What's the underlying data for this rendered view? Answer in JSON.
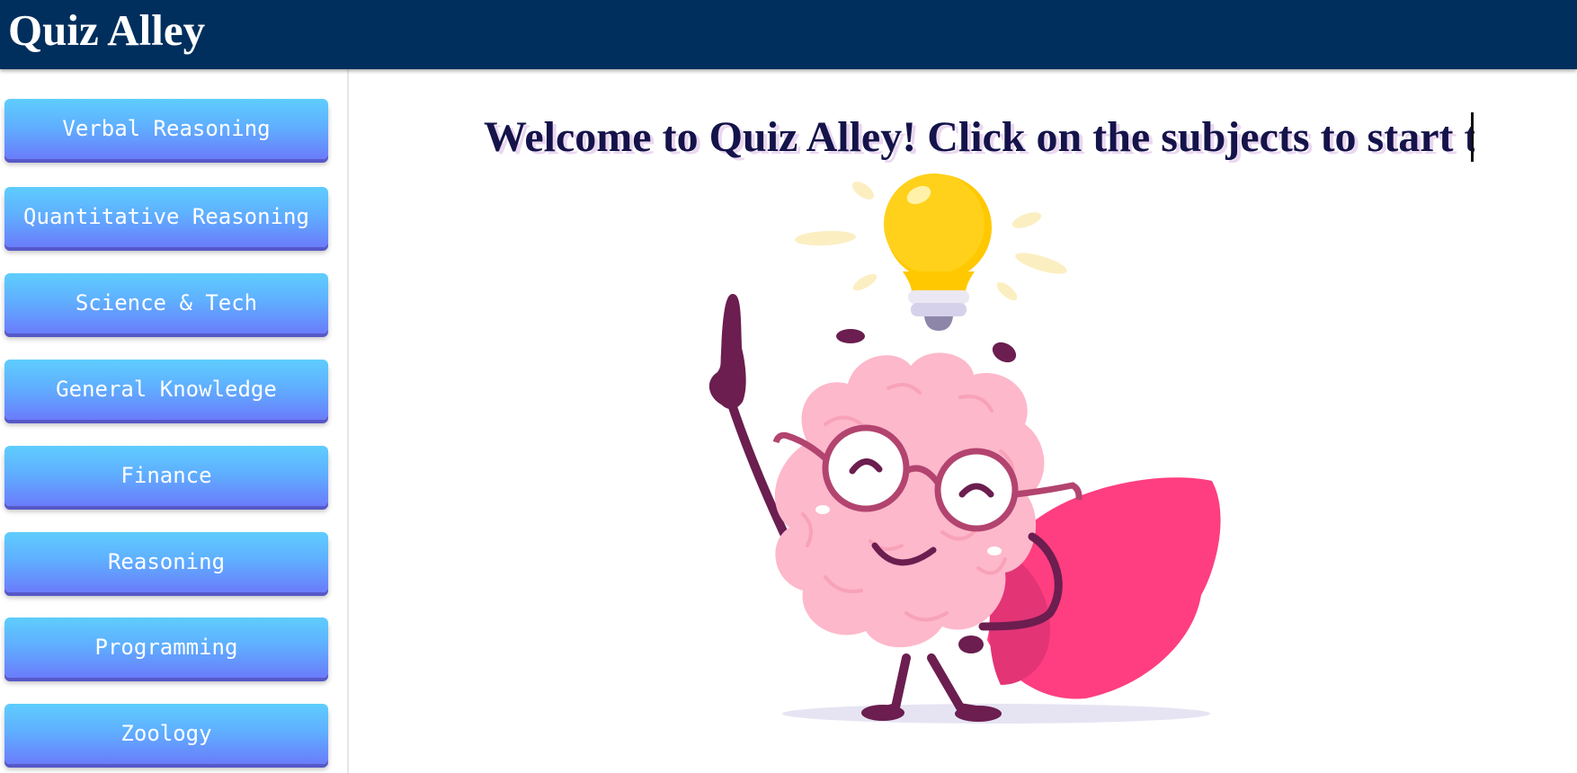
{
  "header": {
    "brand": "Quiz Alley"
  },
  "sidebar": {
    "items": [
      {
        "label": "Verbal Reasoning"
      },
      {
        "label": "Quantitative Reasoning"
      },
      {
        "label": "Science & Tech"
      },
      {
        "label": "General Knowledge"
      },
      {
        "label": "Finance"
      },
      {
        "label": "Reasoning"
      },
      {
        "label": "Programming"
      },
      {
        "label": "Zoology"
      }
    ]
  },
  "main": {
    "welcome": "Welcome to Quiz Alley! Click on the subjects to start the quiz",
    "illustration": "brain-superhero-icon"
  },
  "colors": {
    "header_bg": "#002f5d",
    "button_top": "#5fcdfd",
    "button_bottom": "#6a7cfb",
    "heading": "#14134a"
  }
}
